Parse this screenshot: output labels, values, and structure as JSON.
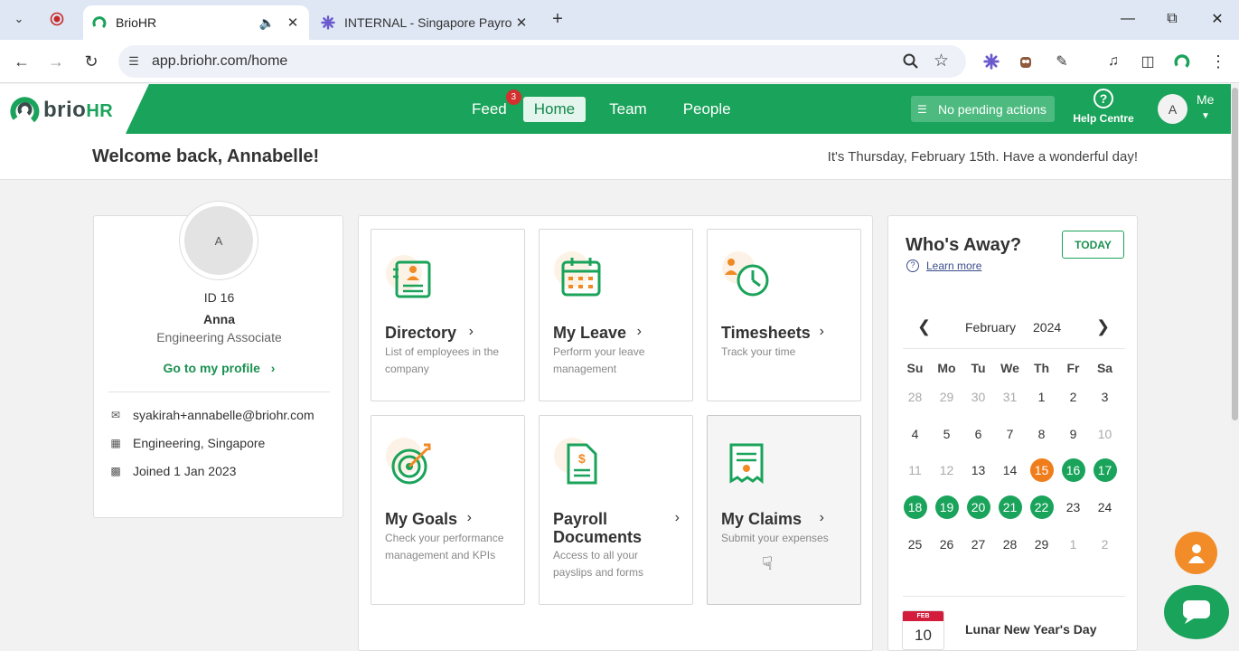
{
  "browser": {
    "tabs": [
      {
        "title": "BrioHR",
        "active": true
      },
      {
        "title": "INTERNAL - Singapore Payroll: E",
        "active": false
      }
    ],
    "url": "app.briohr.com/home",
    "new_tab": "+"
  },
  "header": {
    "logo_text_a": "brio",
    "logo_text_b": "HR",
    "nav": [
      {
        "label": "Feed",
        "badge": "3"
      },
      {
        "label": "Home",
        "active": true
      },
      {
        "label": "Team"
      },
      {
        "label": "People"
      }
    ],
    "pending": "No pending actions",
    "help": "Help Centre",
    "me_initial": "A",
    "me": "Me"
  },
  "welcome": {
    "greeting": "Welcome back, Annabelle!",
    "date_message": "It's Thursday, February 15th. Have a wonderful day!"
  },
  "profile": {
    "initial": "A",
    "id": "ID 16",
    "name": "Anna",
    "role": "Engineering Associate",
    "link": "Go to my profile",
    "email": "syakirah+annabelle@briohr.com",
    "location": "Engineering, Singapore",
    "joined": "Joined 1 Jan 2023"
  },
  "tiles": [
    {
      "title": "Directory",
      "desc": "List of employees in the company"
    },
    {
      "title": "My Leave",
      "desc": "Perform your leave management"
    },
    {
      "title": "Timesheets",
      "desc": "Track your time"
    },
    {
      "title": "My Goals",
      "desc": "Check your performance management and KPIs"
    },
    {
      "title": "Payroll Documents",
      "desc": "Access to all your payslips and forms"
    },
    {
      "title": "My Claims",
      "desc": "Submit your expenses"
    }
  ],
  "away": {
    "title": "Who's Away?",
    "today_btn": "TODAY",
    "learn_more": "Learn more",
    "month": "February",
    "year": "2024",
    "weekdays": [
      "Su",
      "Mo",
      "Tu",
      "We",
      "Th",
      "Fr",
      "Sa"
    ],
    "weeks": [
      [
        {
          "d": "28",
          "s": "muted"
        },
        {
          "d": "29",
          "s": "muted"
        },
        {
          "d": "30",
          "s": "muted"
        },
        {
          "d": "31",
          "s": "muted"
        },
        {
          "d": "1"
        },
        {
          "d": "2"
        },
        {
          "d": "3"
        }
      ],
      [
        {
          "d": "4"
        },
        {
          "d": "5"
        },
        {
          "d": "6"
        },
        {
          "d": "7"
        },
        {
          "d": "8"
        },
        {
          "d": "9"
        },
        {
          "d": "10",
          "s": "muted"
        }
      ],
      [
        {
          "d": "11",
          "s": "muted"
        },
        {
          "d": "12",
          "s": "muted"
        },
        {
          "d": "13"
        },
        {
          "d": "14"
        },
        {
          "d": "15",
          "s": "today"
        },
        {
          "d": "16",
          "s": "away"
        },
        {
          "d": "17",
          "s": "away"
        }
      ],
      [
        {
          "d": "18",
          "s": "away"
        },
        {
          "d": "19",
          "s": "away"
        },
        {
          "d": "20",
          "s": "away"
        },
        {
          "d": "21",
          "s": "away"
        },
        {
          "d": "22",
          "s": "away"
        },
        {
          "d": "23"
        },
        {
          "d": "24"
        }
      ],
      [
        {
          "d": "25"
        },
        {
          "d": "26"
        },
        {
          "d": "27"
        },
        {
          "d": "28"
        },
        {
          "d": "29"
        },
        {
          "d": "1",
          "s": "muted"
        },
        {
          "d": "2",
          "s": "muted"
        }
      ]
    ],
    "holiday": {
      "month": "FEB",
      "day": "10",
      "name": "Lunar New Year's Day"
    }
  },
  "colors": {
    "brand_green": "#1aa35a",
    "today_orange": "#f07d1b",
    "holiday_red": "#d21d3d"
  }
}
